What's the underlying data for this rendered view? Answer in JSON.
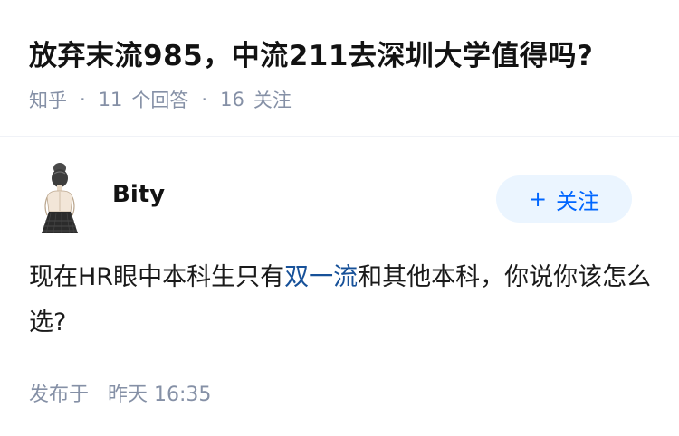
{
  "question": {
    "title": "放弃末流985，中流211去深圳大学值得吗?",
    "source": "知乎",
    "answer_count": "11",
    "answer_label": "个回答",
    "follow_count": "16",
    "follow_label": "关注",
    "separator": "·"
  },
  "author": {
    "name": "Bity",
    "follow_button": "关注",
    "follow_icon": "plus-icon"
  },
  "answer": {
    "text_before": "现在HR眼中本科生只有",
    "link_text": "双一流",
    "text_after": "和其他本科，你说你该怎么选?"
  },
  "answer_meta": {
    "published_label": "发布于",
    "published_time": "昨天 16:35"
  },
  "colors": {
    "meta_gray": "#8590a6",
    "link_blue": "#175199",
    "follow_button_bg": "#ebf5ff",
    "follow_button_text": "#0066ff"
  }
}
